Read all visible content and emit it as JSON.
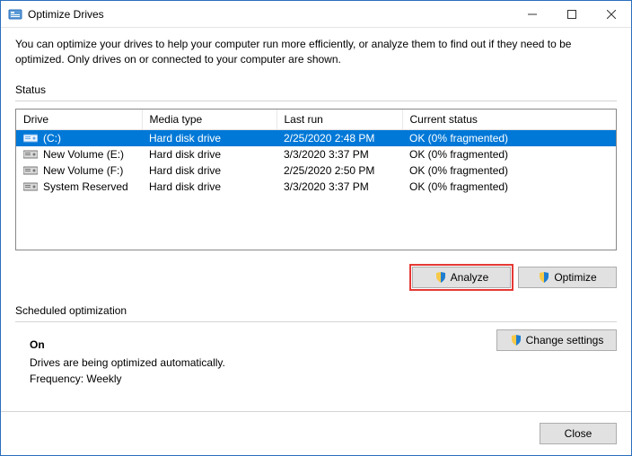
{
  "titlebar": {
    "title": "Optimize Drives"
  },
  "intro": "You can optimize your drives to help your computer run more efficiently, or analyze them to find out if they need to be optimized. Only drives on or connected to your computer are shown.",
  "status": {
    "label": "Status",
    "columns": {
      "drive": "Drive",
      "media": "Media type",
      "lastrun": "Last run",
      "status": "Current status"
    },
    "rows": [
      {
        "drive": "(C:)",
        "media": "Hard disk drive",
        "lastrun": "2/25/2020 2:48 PM",
        "status": "OK (0% fragmented)",
        "selected": true,
        "icon": "primary"
      },
      {
        "drive": "New Volume (E:)",
        "media": "Hard disk drive",
        "lastrun": "3/3/2020 3:37 PM",
        "status": "OK (0% fragmented)",
        "selected": false,
        "icon": "hdd"
      },
      {
        "drive": "New Volume (F:)",
        "media": "Hard disk drive",
        "lastrun": "2/25/2020 2:50 PM",
        "status": "OK (0% fragmented)",
        "selected": false,
        "icon": "hdd"
      },
      {
        "drive": "System Reserved",
        "media": "Hard disk drive",
        "lastrun": "3/3/2020 3:37 PM",
        "status": "OK (0% fragmented)",
        "selected": false,
        "icon": "hdd"
      }
    ]
  },
  "buttons": {
    "analyze": "Analyze",
    "optimize": "Optimize",
    "change_settings": "Change settings",
    "close": "Close"
  },
  "scheduled": {
    "label": "Scheduled optimization",
    "on": "On",
    "auto": "Drives are being optimized automatically.",
    "frequency": "Frequency: Weekly"
  }
}
